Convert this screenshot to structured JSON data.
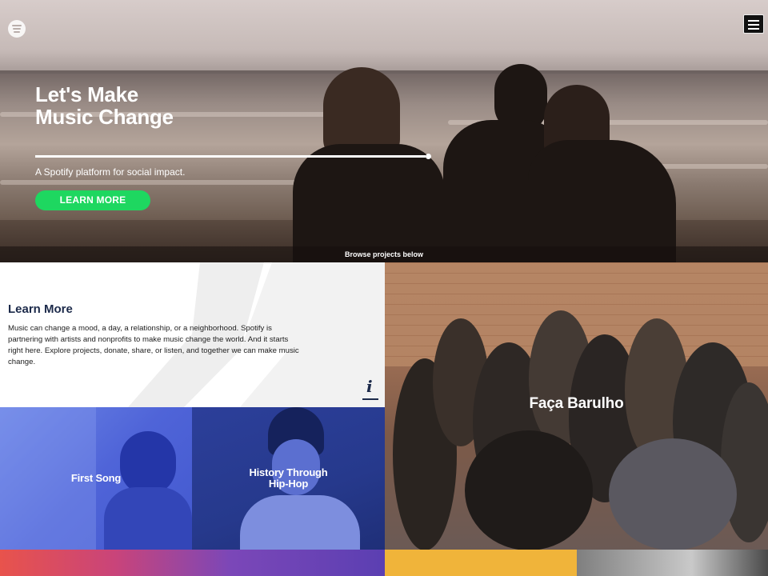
{
  "brand": {
    "logo_icon": "spotify-logo-icon",
    "accent": "#1ed760",
    "navy": "#1c2a4a"
  },
  "header": {
    "menu_icon": "hamburger-menu-icon"
  },
  "hero": {
    "title_line1": "Let's Make",
    "title_line2": "Music Change",
    "subtitle": "A Spotify platform for social impact.",
    "cta_label": "LEARN MORE",
    "browse_label": "Browse projects below"
  },
  "learn": {
    "title": "Learn More",
    "body": "Music can change a mood, a day, a relationship, or a neighborhood. Spotify is partnering with artists and nonprofits to make music change the world. And it starts right here. Explore projects, donate, share, or listen, and together we can make music change.",
    "info_icon": "info-icon"
  },
  "projects": [
    {
      "title": "First Song",
      "color": "#5a70de"
    },
    {
      "title_line1": "History Through",
      "title_line2": "Hip-Hop",
      "color": "#26398c"
    },
    {
      "title": "Faça Barulho",
      "color": "#a07055"
    }
  ]
}
